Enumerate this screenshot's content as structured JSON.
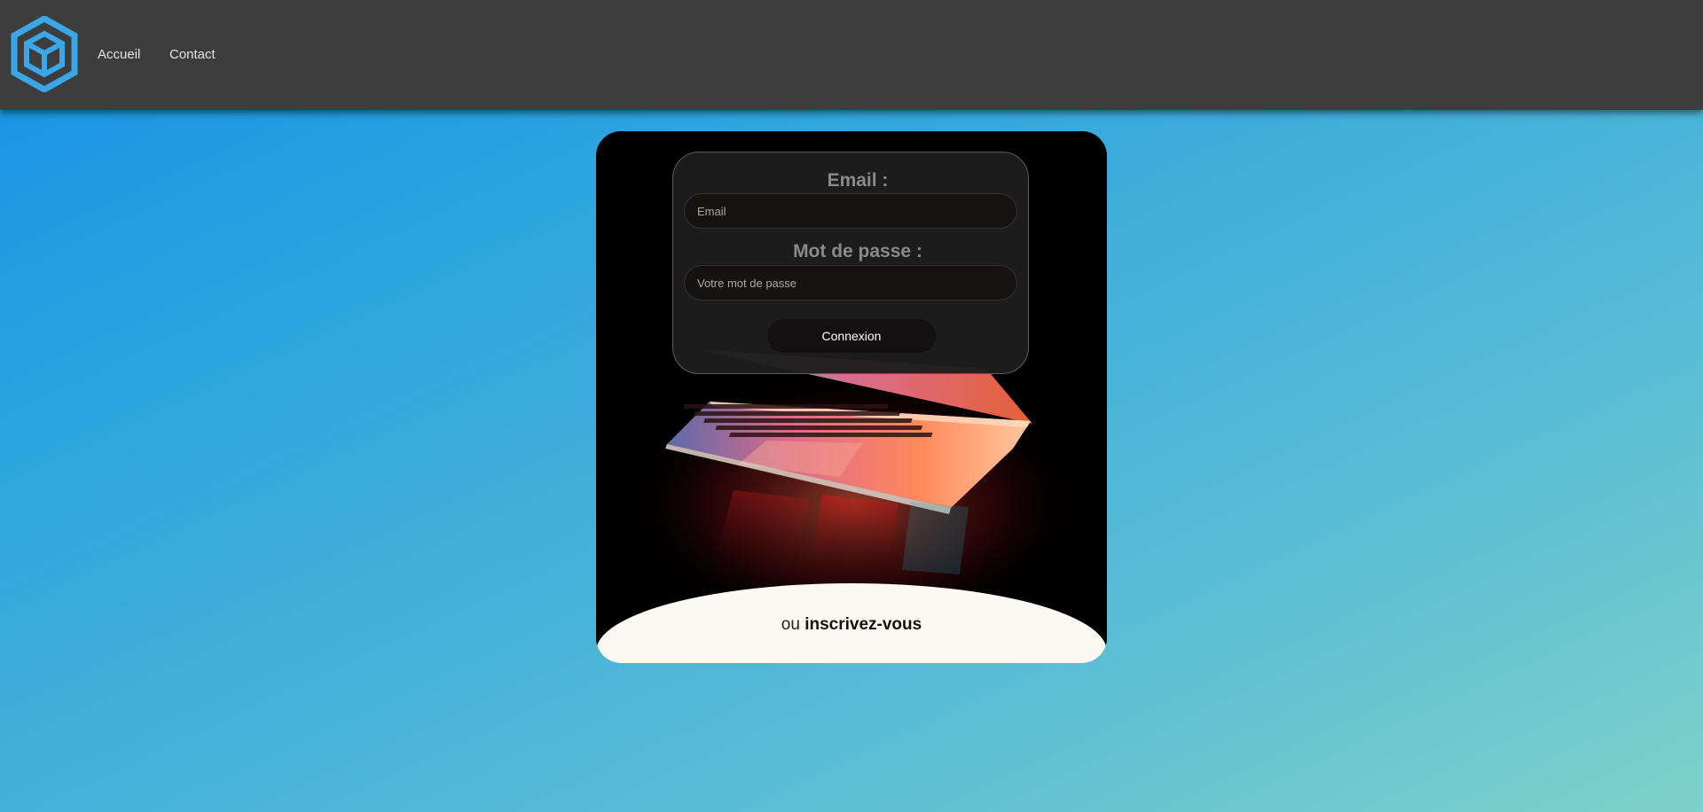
{
  "nav": {
    "logo_icon": "hexagon-cube-logo-icon",
    "links": [
      "Accueil",
      "Contact"
    ]
  },
  "login": {
    "email_label": "Email :",
    "email_placeholder": "Email",
    "password_label": "Mot de passe :",
    "password_placeholder": "Votre mot de passe",
    "submit_label": "Connexion"
  },
  "signup": {
    "prefix": "ou",
    "link_label": "inscrivez-vous"
  },
  "colors": {
    "navbar": "#3d3d3d",
    "logo_blue": "#3aa8e8",
    "background_start": "#1293e6",
    "background_end": "#7dd1c8",
    "signup_panel": "#fbfaf1"
  }
}
